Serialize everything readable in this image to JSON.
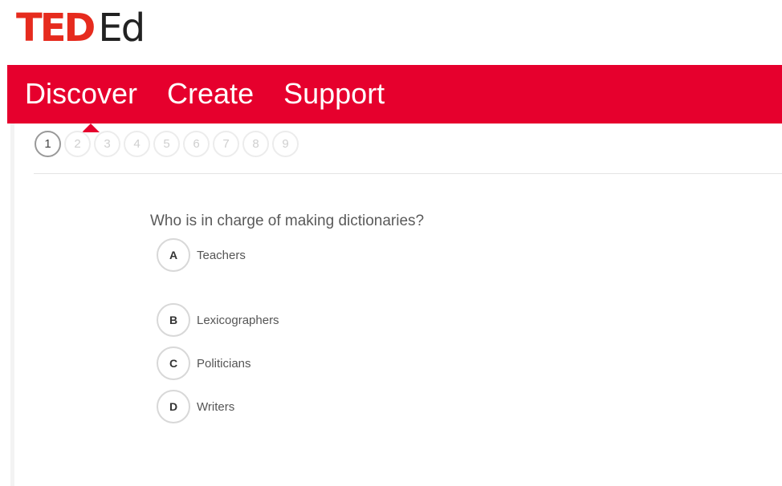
{
  "logo": {
    "ted": "TED",
    "ed": "Ed",
    "brand_color": "#e62b1e"
  },
  "nav": {
    "background": "#e6002d",
    "items": [
      "Discover",
      "Create",
      "Support"
    ],
    "active": "Discover"
  },
  "quiz": {
    "steps": [
      "1",
      "2",
      "3",
      "4",
      "5",
      "6",
      "7",
      "8",
      "9"
    ],
    "current_step": "1",
    "question": "Who is in charge of making dictionaries?",
    "choices": [
      {
        "letter": "A",
        "text": "Teachers"
      },
      {
        "letter": "B",
        "text": "Lexicographers"
      },
      {
        "letter": "C",
        "text": "Politicians"
      },
      {
        "letter": "D",
        "text": "Writers"
      }
    ]
  }
}
